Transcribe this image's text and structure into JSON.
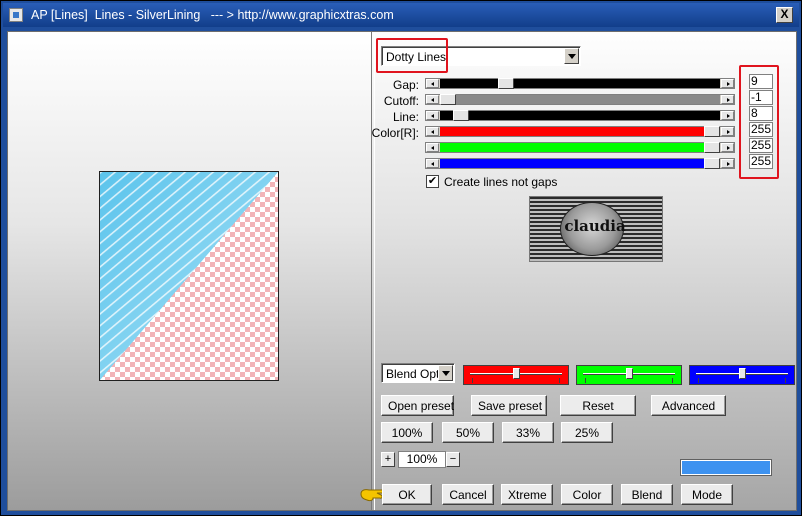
{
  "window": {
    "title": "AP [Lines]  Lines - SilverLining   --- > http://www.graphicxtras.com",
    "close_label": "X",
    "icon": "app-icon"
  },
  "effect_select": {
    "selected": "Dotty Lines"
  },
  "params": [
    {
      "label": "Gap:",
      "value": "9",
      "position": 0.22,
      "track_color": "#000000"
    },
    {
      "label": "Cutoff:",
      "value": "-1",
      "position": 0.0,
      "track_color": "#8a8a8a"
    },
    {
      "label": "Line:",
      "value": "8",
      "position": 0.05,
      "track_color": "#000000"
    },
    {
      "label": "Color[R]:",
      "value": "255",
      "position": 1.0,
      "track_color": "#ff0000"
    },
    {
      "label": "",
      "value": "255",
      "position": 1.0,
      "track_color": "#00ff00"
    },
    {
      "label": "",
      "value": "255",
      "position": 1.0,
      "track_color": "#0000ff"
    }
  ],
  "checkbox": {
    "label": "Create lines not gaps",
    "checked": true,
    "mark": "✔"
  },
  "logo": {
    "text": "claudia"
  },
  "blend": {
    "selected": "Blend Options",
    "color_sliders": [
      {
        "color": "#ff0000",
        "position": 0.5
      },
      {
        "color": "#00ff00",
        "position": 0.5
      },
      {
        "color": "#0000ff",
        "position": 0.5
      }
    ]
  },
  "buttons": {
    "open_preset": "Open preset",
    "save_preset": "Save preset",
    "reset": "Reset",
    "advanced": "Advanced",
    "zoom_100": "100%",
    "zoom_50": "50%",
    "zoom_33": "33%",
    "zoom_25": "25%",
    "zoom_plus": "+",
    "zoom_minus": "−",
    "ok": "OK",
    "cancel": "Cancel",
    "xtreme": "Xtreme",
    "color": "Color",
    "blend": "Blend",
    "mode": "Mode"
  },
  "zoom": {
    "value": "100%"
  },
  "colors": {
    "highlight": "#e0141e",
    "swatch": "#3d92f0",
    "preview_blue": "#6cc8ee",
    "checker_pink": "#f2b4b8"
  }
}
